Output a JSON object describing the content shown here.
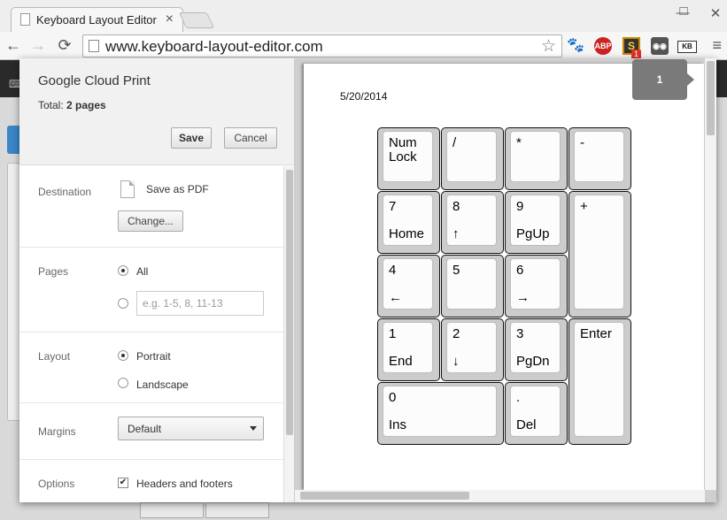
{
  "browser": {
    "tab_title": "Keyboard Layout Editor",
    "tab_close": "×",
    "url": "www.keyboard-layout-editor.com",
    "back": "←",
    "forward": "→",
    "reload": "⟳",
    "star": "☆",
    "menu": "≡",
    "minimize": "—",
    "maximize": "□",
    "close": "✕",
    "extensions": {
      "paw_icon": "🐾",
      "abp_label": "ABP",
      "s_label": "S",
      "s_badge": "1",
      "kb_label": "KB"
    }
  },
  "print_dialog": {
    "title": "Google Cloud Print",
    "total_label": "Total:",
    "total_value": "2 pages",
    "save_label": "Save",
    "cancel_label": "Cancel",
    "destination": {
      "label": "Destination",
      "value": "Save as PDF",
      "change_label": "Change..."
    },
    "pages": {
      "label": "Pages",
      "all_label": "All",
      "all_selected": true,
      "range_placeholder": "e.g. 1-5, 8, 11-13"
    },
    "layout": {
      "label": "Layout",
      "portrait_label": "Portrait",
      "landscape_label": "Landscape",
      "selected": "Portrait"
    },
    "margins": {
      "label": "Margins",
      "value": "Default"
    },
    "options": {
      "label": "Options",
      "headers_footers_label": "Headers and footers",
      "headers_footers_checked": true
    }
  },
  "preview": {
    "date": "5/20/2014",
    "page_number": "1",
    "keys": [
      {
        "l1": "Num\nLock",
        "l2": ""
      },
      {
        "l1": "/",
        "l2": ""
      },
      {
        "l1": "*",
        "l2": ""
      },
      {
        "l1": "-",
        "l2": ""
      },
      {
        "l1": "7",
        "l2": "Home"
      },
      {
        "l1": "8",
        "l2": "↑"
      },
      {
        "l1": "9",
        "l2": "PgUp"
      },
      {
        "l1": "+",
        "l2": ""
      },
      {
        "l1": "4",
        "l2": "←"
      },
      {
        "l1": "5",
        "l2": ""
      },
      {
        "l1": "6",
        "l2": "→"
      },
      {
        "l1": "1",
        "l2": "End"
      },
      {
        "l1": "2",
        "l2": "↓"
      },
      {
        "l1": "3",
        "l2": "PgDn"
      },
      {
        "l1": "Enter",
        "l2": ""
      },
      {
        "l1": "0",
        "l2": "Ins"
      },
      {
        "l1": ".",
        "l2": "Del"
      }
    ]
  }
}
